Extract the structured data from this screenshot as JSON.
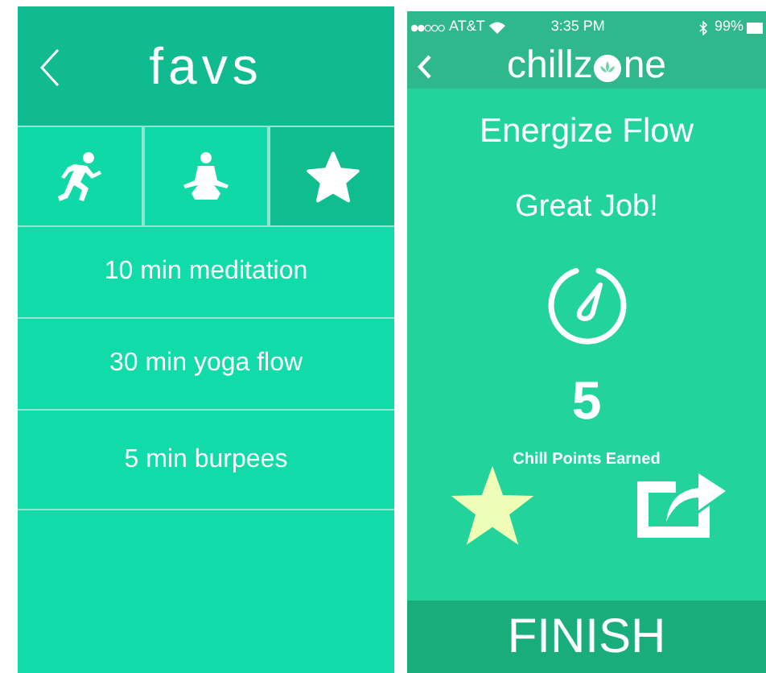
{
  "favs_screen": {
    "title": "favs",
    "tabs": [
      {
        "kind": "running",
        "selected": false
      },
      {
        "kind": "meditation",
        "selected": false
      },
      {
        "kind": "star",
        "selected": true
      }
    ],
    "items": [
      "10 min meditation",
      "30 min yoga flow",
      "5 min burpees"
    ]
  },
  "result_screen": {
    "status_bar": {
      "carrier": "AT&T",
      "time": "3:35 PM",
      "battery": "99%"
    },
    "logo": {
      "before": "chillz",
      "after": "ne"
    },
    "workout": "Energize Flow",
    "message": "Great Job!",
    "points": "5",
    "points_label": "Chill Points Earned",
    "favorited": true,
    "finish_button": "FINISH"
  }
}
